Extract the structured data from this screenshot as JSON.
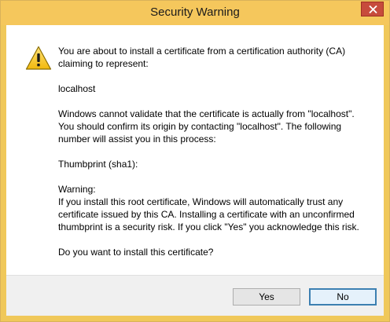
{
  "window": {
    "title": "Security Warning"
  },
  "icons": {
    "warning": "warning-triangle-icon",
    "close": "close-icon"
  },
  "colors": {
    "titlebar": "#f5c75c",
    "close_button": "#c74b3c",
    "default_button_border": "#3c7fb1"
  },
  "message": {
    "intro": "You are about to install a certificate from a certification authority (CA) claiming to represent:",
    "host": "localhost",
    "validation": "Windows cannot validate that the certificate is actually from \"localhost\". You should confirm its origin by contacting \"localhost\". The following number will assist you in this process:",
    "thumbprint_label": "Thumbprint (sha1):",
    "warning_heading": "Warning:",
    "warning_body": "If you install this root certificate, Windows will automatically trust any certificate issued by this CA. Installing a certificate with an unconfirmed thumbprint is a security risk. If you click \"Yes\" you acknowledge this risk.",
    "question": "Do you want to install this certificate?"
  },
  "buttons": {
    "yes": "Yes",
    "no": "No"
  }
}
